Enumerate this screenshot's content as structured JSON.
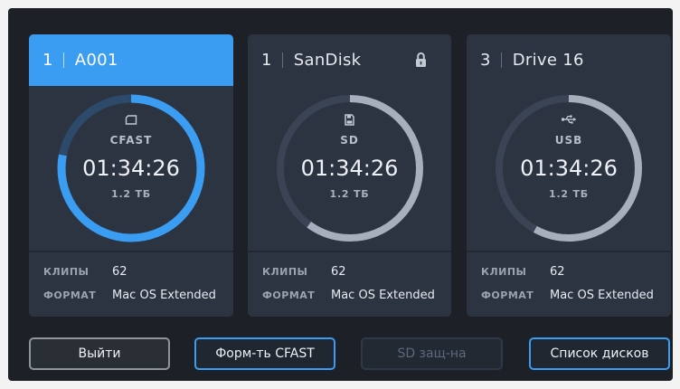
{
  "colors": {
    "accent": "#3b9df2",
    "screen_bg": "#1d2026",
    "card_bg": "#2c3341",
    "arc_gray": "#a7afbc",
    "track_gray": "#3b4454",
    "track_selected": "#2d4a6b",
    "disabled_text": "#5d697a"
  },
  "labels": {
    "clips": "КЛИПЫ",
    "format": "ФОРМАТ"
  },
  "cards": [
    {
      "slot": "1",
      "name": "A001",
      "selected": true,
      "locked": false,
      "media_icon": "cfast-card-icon",
      "media": "CFAST",
      "remaining_time": "01:34:26",
      "capacity": "1.2 ТБ",
      "ring_fill": 0.78,
      "clips": "62",
      "format": "Mac OS Extended"
    },
    {
      "slot": "1",
      "name": "SanDisk",
      "selected": false,
      "locked": true,
      "status_icon": "lock-icon",
      "media_icon": "sd-card-icon",
      "media": "SD",
      "remaining_time": "01:34:26",
      "capacity": "1.2 ТБ",
      "ring_fill": 0.6,
      "clips": "62",
      "format": "Mac OS Extended"
    },
    {
      "slot": "3",
      "name": "Drive 16",
      "selected": false,
      "locked": false,
      "media_icon": "usb-icon",
      "media": "USB",
      "remaining_time": "01:34:26",
      "capacity": "1.2 ТБ",
      "ring_fill": 0.58,
      "clips": "62",
      "format": "Mac OS Extended"
    }
  ],
  "buttons": {
    "exit": {
      "label": "Выйти",
      "highlighted": false,
      "disabled": false
    },
    "format_cfast": {
      "label": "Форм-ть CFAST",
      "highlighted": true,
      "disabled": false
    },
    "sd_protect": {
      "label": "SD защ-на",
      "highlighted": false,
      "disabled": true
    },
    "disk_list": {
      "label": "Список дисков",
      "highlighted": true,
      "disabled": false
    }
  }
}
